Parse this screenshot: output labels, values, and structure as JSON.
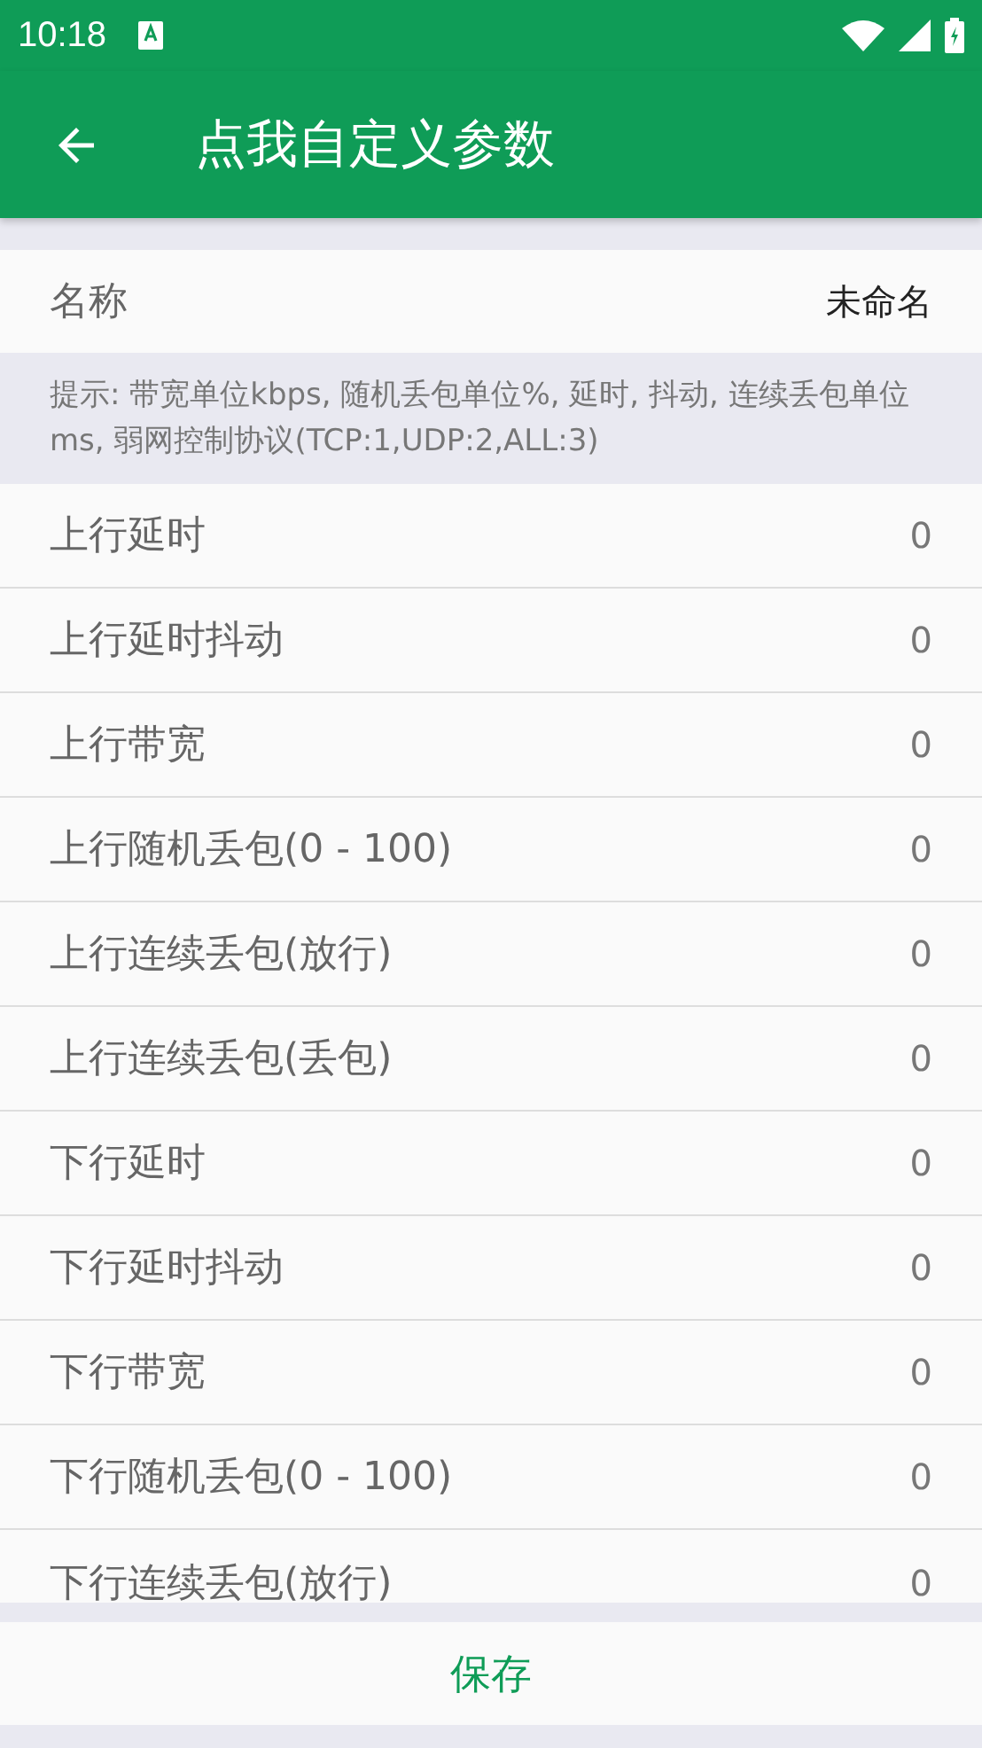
{
  "status_bar": {
    "time": "10:18"
  },
  "app_bar": {
    "title": "点我自定义参数"
  },
  "name_row": {
    "label": "名称",
    "value": "未命名"
  },
  "hint": "提示: 带宽单位kbps, 随机丢包单位%, 延时, 抖动, 连续丢包单位ms, 弱网控制协议(TCP:1,UDP:2,ALL:3)",
  "params": [
    {
      "label": "上行延时",
      "value": "0"
    },
    {
      "label": "上行延时抖动",
      "value": "0"
    },
    {
      "label": "上行带宽",
      "value": "0"
    },
    {
      "label": "上行随机丢包(0 - 100)",
      "value": "0"
    },
    {
      "label": "上行连续丢包(放行)",
      "value": "0"
    },
    {
      "label": "上行连续丢包(丢包)",
      "value": "0"
    },
    {
      "label": "下行延时",
      "value": "0"
    },
    {
      "label": "下行延时抖动",
      "value": "0"
    },
    {
      "label": "下行带宽",
      "value": "0"
    },
    {
      "label": "下行随机丢包(0 - 100)",
      "value": "0"
    },
    {
      "label": "下行连续丢包(放行)",
      "value": "0"
    }
  ],
  "save_button": "保存"
}
